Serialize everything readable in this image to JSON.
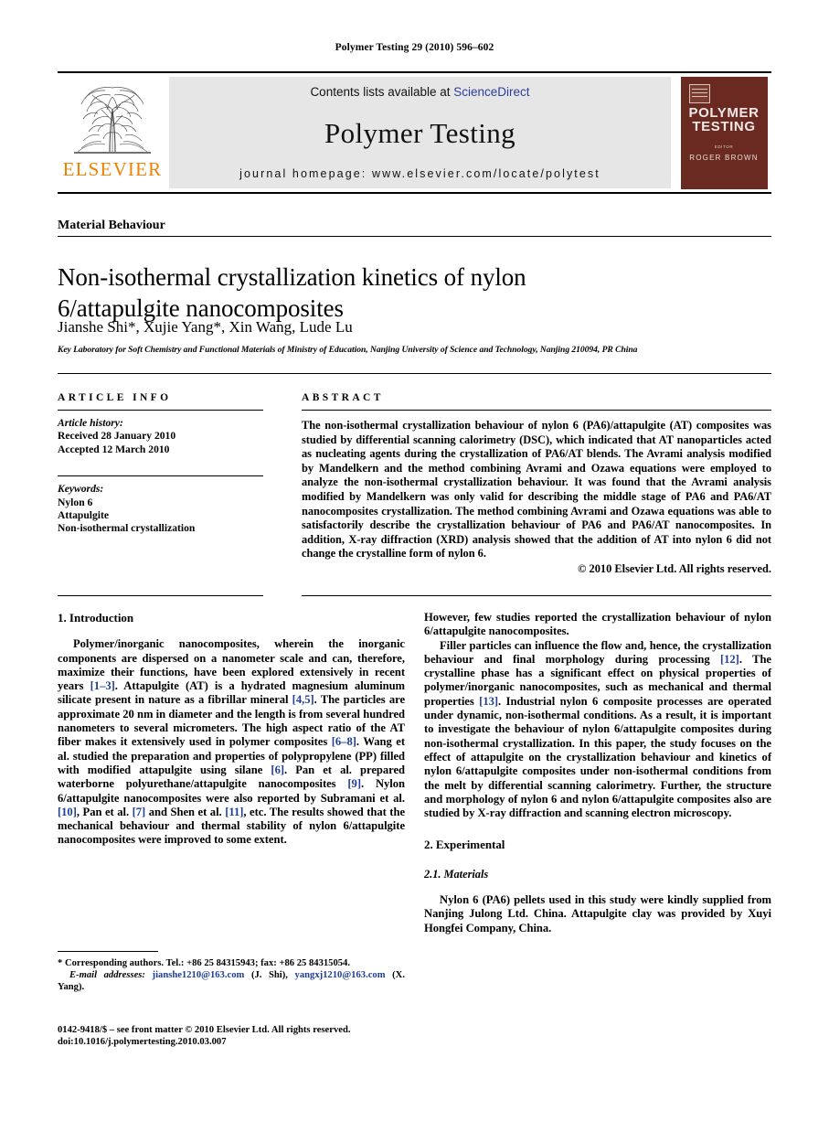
{
  "running_head": "Polymer Testing 29 (2010) 596–602",
  "banner": {
    "contents_prefix": "Contents lists available at ",
    "sciencedirect": "ScienceDirect",
    "journal_title": "Polymer Testing",
    "homepage": "journal homepage: www.elsevier.com/locate/polytest",
    "publisher_wordmark": "ELSEVIER",
    "cover": {
      "title_line1": "POLYMER",
      "title_line2": "TESTING",
      "editor_label": "EDITOR",
      "editor_name": "ROGER BROWN",
      "background_color": "#6a2a22"
    }
  },
  "article": {
    "section_label": "Material Behaviour",
    "title": "Non-isothermal crystallization kinetics of nylon 6/attapulgite nanocomposites",
    "authors": "Jianshe Shi*, Xujie Yang*, Xin Wang, Lude Lu",
    "affiliation": "Key Laboratory for Soft Chemistry and Functional Materials of Ministry of Education, Nanjing University of Science and Technology, Nanjing 210094, PR China"
  },
  "article_info": {
    "heading": "ARTICLE INFO",
    "history_label": "Article history:",
    "received": "Received 28 January 2010",
    "accepted": "Accepted 12 March 2010",
    "keywords_label": "Keywords:",
    "keywords": [
      "Nylon 6",
      "Attapulgite",
      "Non-isothermal crystallization"
    ]
  },
  "abstract": {
    "heading": "ABSTRACT",
    "text": "The non-isothermal crystallization behaviour of nylon 6 (PA6)/attapulgite (AT) composites was studied by differential scanning calorimetry (DSC), which indicated that AT nanoparticles acted as nucleating agents during the crystallization of PA6/AT blends. The Avrami analysis modified by Mandelkern and the method combining Avrami and Ozawa equations were employed to analyze the non-isothermal crystallization behaviour. It was found that the Avrami analysis modified by Mandelkern was only valid for describing the middle stage of PA6 and PA6/AT nanocomposites crystallization. The method combining Avrami and Ozawa equations was able to satisfactorily describe the crystallization behaviour of PA6 and PA6/AT nanocomposites. In addition, X-ray diffraction (XRD) analysis showed that the addition of AT into nylon 6 did not change the crystalline form of nylon 6.",
    "copyright": "© 2010 Elsevier Ltd. All rights reserved."
  },
  "body": {
    "intro_heading": "1. Introduction",
    "left_paragraphs": [
      "Polymer/inorganic nanocomposites, wherein the inorganic components are dispersed on a nanometer scale and can, therefore, maximize their functions, have been explored extensively in recent years [1–3]. Attapulgite (AT) is a hydrated magnesium aluminum silicate present in nature as a fibrillar mineral [4,5]. The particles are approximate 20 nm in diameter and the length is from several hundred nanometers to several micrometers. The high aspect ratio of the AT fiber makes it extensively used in polymer composites [6–8]. Wang et al. studied the preparation and properties of polypropylene (PP) filled with modified attapulgite using silane [6]. Pan et al. prepared waterborne polyurethane/attapulgite nanocomposites [9]. Nylon 6/attapulgite nanocomposites were also reported by Subramani et al. [10], Pan et al. [7] and Shen et al. [11], etc. The results showed that the mechanical behaviour and thermal stability of nylon 6/attapulgite nanocomposites were improved to some extent."
    ],
    "right_paragraphs": [
      "However, few studies reported the crystallization behaviour of nylon 6/attapulgite nanocomposites.",
      "Filler particles can influence the flow and, hence, the crystallization behaviour and final morphology during processing [12]. The crystalline phase has a significant effect on physical properties of polymer/inorganic nanocomposites, such as mechanical and thermal properties [13]. Industrial nylon 6 composite processes are operated under dynamic, non-isothermal conditions. As a result, it is important to investigate the behaviour of nylon 6/attapulgite composites during non-isothermal crystallization. In this paper, the study focuses on the effect of attapulgite on the crystallization behaviour and kinetics of nylon 6/attapulgite composites under non-isothermal conditions from the melt by differential scanning calorimetry. Further, the structure and morphology of nylon 6 and nylon 6/attapulgite composites also are studied by X-ray diffraction and scanning electron microscopy."
    ],
    "experimental_heading": "2. Experimental",
    "materials_heading": "2.1. Materials",
    "materials_paragraph": "Nylon 6 (PA6) pellets used in this study were kindly supplied from Nanjing Julong Ltd. China. Attapulgite clay was provided by Xuyi Hongfei Company, China."
  },
  "footnotes": {
    "corresponding": "* Corresponding authors. Tel.: +86 25 84315943; fax: +86 25 84315054.",
    "email_label": "E-mail addresses:",
    "email1": "jianshe1210@163.com",
    "email1_attr": "(J. Shi),",
    "email2": "yangxj1210@163.com",
    "email2_attr": "(X. Yang)."
  },
  "imprint": {
    "line1": "0142-9418/$ – see front matter © 2010 Elsevier Ltd. All rights reserved.",
    "line2": "doi:10.1016/j.polymertesting.2010.03.007"
  }
}
